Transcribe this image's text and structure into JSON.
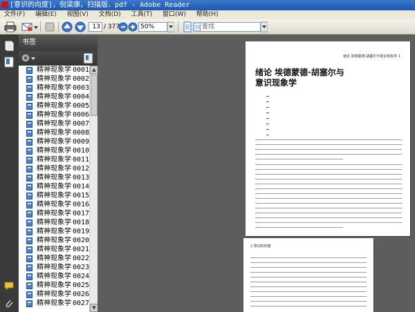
{
  "window": {
    "title": "[意识的向度]，倪梁康，扫描版．pdf - Adobe Reader"
  },
  "menu": [
    "文件(F)",
    "编辑(E)",
    "视图(V)",
    "文档(D)",
    "工具(T)",
    "窗口(W)",
    "帮助(H)"
  ],
  "toolbar": {
    "page_current": "13",
    "page_total": "/ 377",
    "zoom": "50%",
    "search_placeholder": "查找"
  },
  "bookmarks": {
    "header": "书签",
    "items": [
      {
        "label": "精神现象学",
        "num": "0001"
      },
      {
        "label": "精神现象学",
        "num": "0002"
      },
      {
        "label": "精神现象学",
        "num": "0003"
      },
      {
        "label": "精神现象学",
        "num": "0004"
      },
      {
        "label": "精神现象学",
        "num": "0005"
      },
      {
        "label": "精神现象学",
        "num": "0006"
      },
      {
        "label": "精神现象学",
        "num": "0007"
      },
      {
        "label": "精神现象学",
        "num": "0008"
      },
      {
        "label": "精神现象学",
        "num": "0009"
      },
      {
        "label": "精神现象学",
        "num": "0010"
      },
      {
        "label": "精神现象学",
        "num": "0011"
      },
      {
        "label": "精神现象学",
        "num": "0012"
      },
      {
        "label": "精神现象学",
        "num": "0013"
      },
      {
        "label": "精神现象学",
        "num": "0014"
      },
      {
        "label": "精神现象学",
        "num": "0015"
      },
      {
        "label": "精神现象学",
        "num": "0016"
      },
      {
        "label": "精神现象学",
        "num": "0017"
      },
      {
        "label": "精神现象学",
        "num": "0018"
      },
      {
        "label": "精神现象学",
        "num": "0019"
      },
      {
        "label": "精神现象学",
        "num": "0020"
      },
      {
        "label": "精神现象学",
        "num": "0021"
      },
      {
        "label": "精神现象学",
        "num": "0022"
      },
      {
        "label": "精神现象学",
        "num": "0023"
      },
      {
        "label": "精神现象学",
        "num": "0024"
      },
      {
        "label": "精神现象学",
        "num": "0025"
      },
      {
        "label": "精神现象学",
        "num": "0026"
      },
      {
        "label": "精神现象学",
        "num": "0027"
      }
    ]
  },
  "document": {
    "page1": {
      "running_head": "绪论  埃德蒙德·胡塞尔与意识现象学   1",
      "title_line1": "绪论   埃德蒙德·胡塞尔与",
      "title_line2": "意识现象学"
    },
    "page2": {
      "running_head": "2   意识的向度"
    }
  },
  "colors": {
    "titlebar": "#1d56b4",
    "doc_background": "#5d5d5d",
    "panel_header": "#3c3c3c",
    "bookmark_icon": "#4f7fc4"
  }
}
